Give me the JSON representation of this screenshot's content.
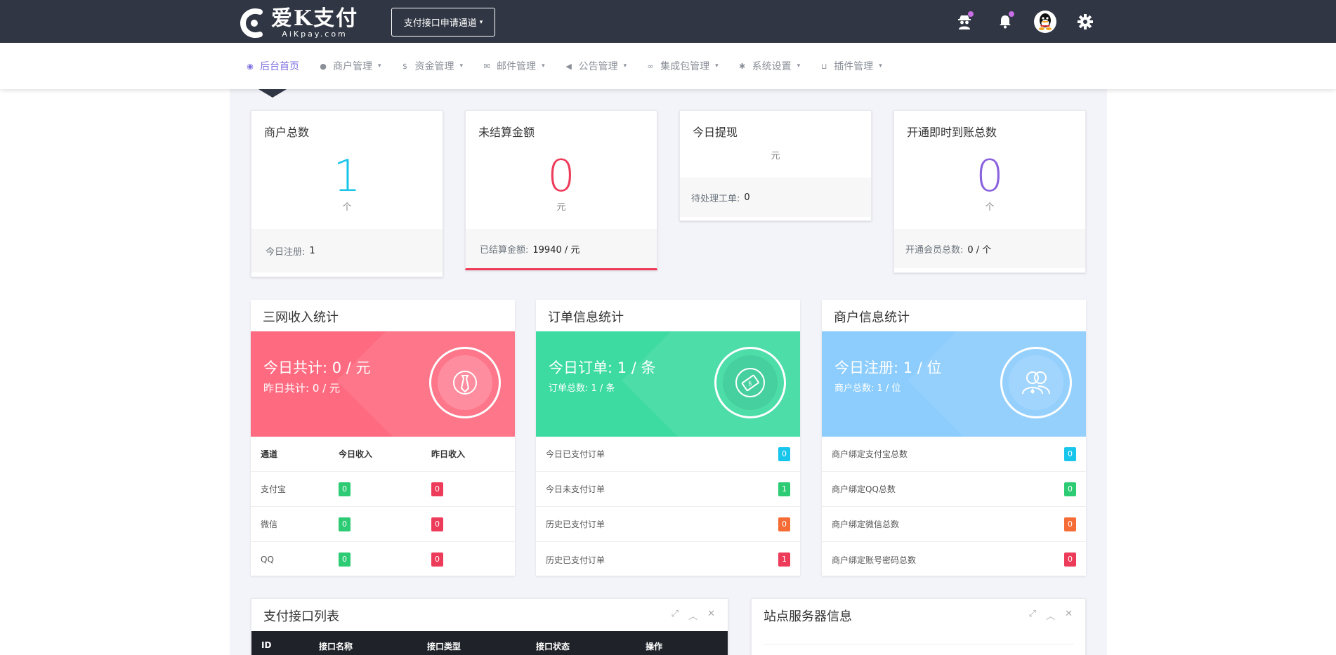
{
  "header": {
    "logo_text": "爱K支付",
    "logo_sub": "AiKpay.com",
    "apply_button": "支付接口申请通道",
    "icons": [
      "user-spy-icon",
      "bell-icon",
      "qq-avatar-icon",
      "gear-icon"
    ]
  },
  "nav": {
    "items": [
      {
        "label": "后台首页",
        "icon": "dashboard-icon"
      },
      {
        "label": "商户管理",
        "icon": "user-icon"
      },
      {
        "label": "资金管理",
        "icon": "money-icon"
      },
      {
        "label": "邮件管理",
        "icon": "mail-icon"
      },
      {
        "label": "公告管理",
        "icon": "speaker-icon"
      },
      {
        "label": "集成包管理",
        "icon": "package-icon"
      },
      {
        "label": "系统设置",
        "icon": "gear-icon"
      },
      {
        "label": "插件管理",
        "icon": "cart-icon"
      }
    ]
  },
  "stats": [
    {
      "title": "商户总数",
      "value": "1",
      "unit": "个",
      "foot_label": "今日注册:",
      "foot_value": "1"
    },
    {
      "title": "未结算金额",
      "value": "0",
      "unit": "元",
      "foot_label": "已结算金额:",
      "foot_value": "19940 / 元"
    },
    {
      "title": "今日提现",
      "value": "",
      "unit": "元",
      "foot_label": "待处理工单:",
      "foot_value": "0"
    },
    {
      "title": "开通即时到账总数",
      "value": "0",
      "unit": "个",
      "foot_label": "开通会员总数:",
      "foot_value": "0 / 个"
    }
  ],
  "income": {
    "title": "三网收入统计",
    "main": "今日共计: 0 / 元",
    "sub": "昨日共计: 0 / 元",
    "color": "#fe6b81",
    "headers": [
      "通道",
      "今日收入",
      "昨日收入"
    ],
    "rows": [
      {
        "name": "支付宝",
        "today": "0",
        "yesterday": "0"
      },
      {
        "name": "微信",
        "today": "0",
        "yesterday": "0"
      },
      {
        "name": "QQ",
        "today": "0",
        "yesterday": "0"
      }
    ]
  },
  "orders": {
    "title": "订单信息统计",
    "main": "今日订单: 1 / 条",
    "sub": "订单总数: 1 / 条",
    "color": "#3ddba2",
    "rows": [
      {
        "label": "今日已支付订单",
        "value": "0",
        "color": "cyan"
      },
      {
        "label": "今日未支付订单",
        "value": "1",
        "color": "green"
      },
      {
        "label": "历史已支付订单",
        "value": "0",
        "color": "orange"
      },
      {
        "label": "历史已支付订单",
        "value": "1",
        "color": "red"
      }
    ]
  },
  "merchants": {
    "title": "商户信息统计",
    "main": "今日注册: 1 / 位",
    "sub": "商户总数: 1 / 位",
    "color": "#8dcdfd",
    "rows": [
      {
        "label": "商户绑定支付宝总数",
        "value": "0",
        "color": "cyan"
      },
      {
        "label": "商户绑定QQ总数",
        "value": "0",
        "color": "green"
      },
      {
        "label": "商户绑定微信总数",
        "value": "0",
        "color": "orange"
      },
      {
        "label": "商户绑定账号密码总数",
        "value": "0",
        "color": "red"
      }
    ]
  },
  "pay_list": {
    "title": "支付接口列表",
    "columns": [
      "ID",
      "接口名称",
      "接口类型",
      "接口状态",
      "操作"
    ]
  },
  "server_info": {
    "title": "站点服务器信息"
  }
}
